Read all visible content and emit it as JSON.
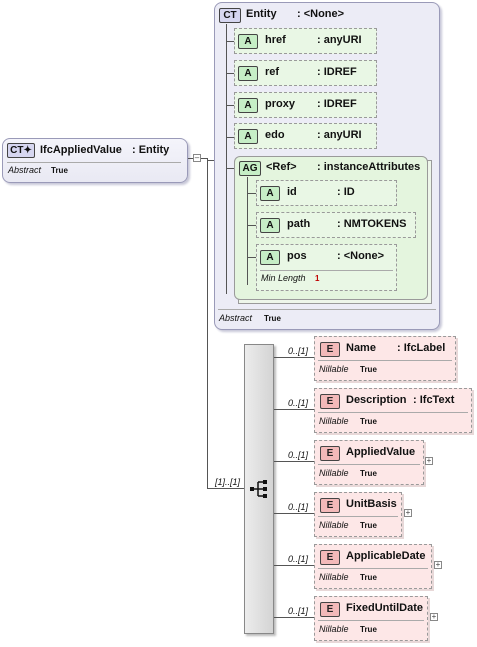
{
  "root": {
    "badge": "CT",
    "name": "IfcAppliedValue",
    "type": ": Entity",
    "abstract_label": "Abstract",
    "abstract_value": "True"
  },
  "entity": {
    "badge": "CT",
    "name": "Entity",
    "type": ": <None>",
    "abstract_label": "Abstract",
    "abstract_value": "True",
    "attributes": [
      {
        "badge": "A",
        "name": "href",
        "type": ": anyURI"
      },
      {
        "badge": "A",
        "name": "ref",
        "type": ": IDREF"
      },
      {
        "badge": "A",
        "name": "proxy",
        "type": ": IDREF"
      },
      {
        "badge": "A",
        "name": "edo",
        "type": ": anyURI"
      }
    ],
    "group": {
      "badge": "AG",
      "name": "<Ref>",
      "type": ": instanceAttributes",
      "attributes": [
        {
          "badge": "A",
          "name": "id",
          "type": ": ID"
        },
        {
          "badge": "A",
          "name": "path",
          "type": ": NMTOKENS"
        },
        {
          "badge": "A",
          "name": "pos",
          "type": ": <None>",
          "facet_label": "Min Length",
          "facet_value": "1"
        }
      ]
    }
  },
  "sequence": {
    "multiplicity": "[1]..[1]"
  },
  "elements": [
    {
      "badge": "E",
      "name": "Name",
      "type": ": IfcLabel",
      "mult": "0..[1]",
      "nillable_label": "Nillable",
      "nillable_value": "True"
    },
    {
      "badge": "E",
      "name": "Description",
      "type": ": IfcText",
      "mult": "0..[1]",
      "nillable_label": "Nillable",
      "nillable_value": "True"
    },
    {
      "badge": "E",
      "name": "AppliedValue",
      "type": "",
      "mult": "0..[1]",
      "nillable_label": "Nillable",
      "nillable_value": "True"
    },
    {
      "badge": "E",
      "name": "UnitBasis",
      "type": "",
      "mult": "0..[1]",
      "nillable_label": "Nillable",
      "nillable_value": "True"
    },
    {
      "badge": "E",
      "name": "ApplicableDate",
      "type": "",
      "mult": "0..[1]",
      "nillable_label": "Nillable",
      "nillable_value": "True"
    },
    {
      "badge": "E",
      "name": "FixedUntilDate",
      "type": "",
      "mult": "0..[1]",
      "nillable_label": "Nillable",
      "nillable_value": "True"
    }
  ]
}
